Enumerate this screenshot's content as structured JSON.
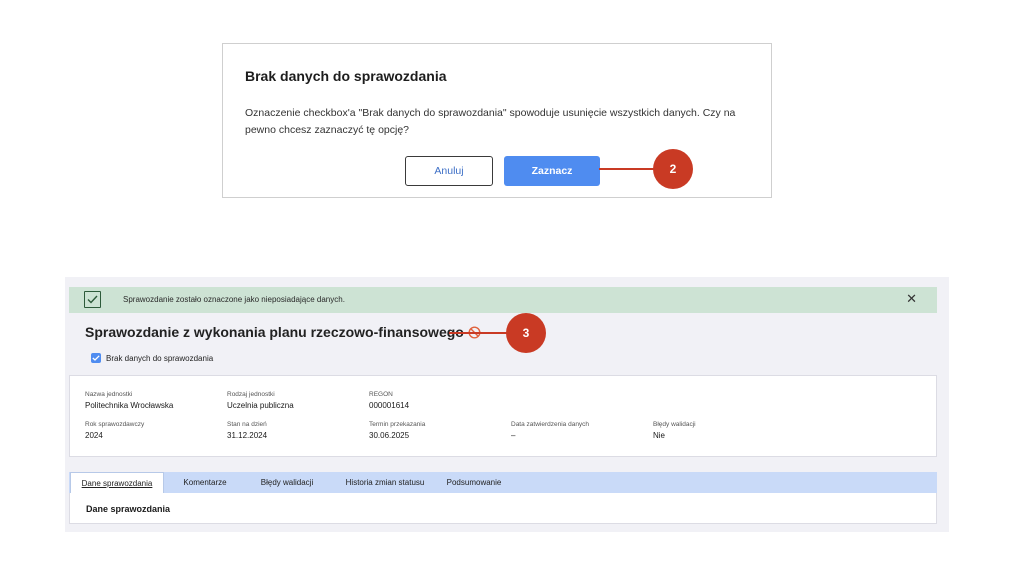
{
  "dialog": {
    "title": "Brak danych do sprawozdania",
    "message": "Oznaczenie checkbox'a \"Brak danych do sprawozdania\" spowoduje usunięcie wszystkich danych. Czy na pewno chcesz zaznaczyć tę opcję?",
    "cancel_label": "Anuluj",
    "confirm_label": "Zaznacz"
  },
  "callouts": {
    "first": "2",
    "second": "3"
  },
  "alert": {
    "text": "Sprawozdanie zostało oznaczone jako nieposiadające danych.",
    "close_icon": "close-icon"
  },
  "report": {
    "title": "Sprawozdanie z wykonania planu rzeczowo-finansowego",
    "title_icon": "ban-icon",
    "checkbox_label": "Brak danych do sprawozdania",
    "checkbox_checked": true
  },
  "info": {
    "unit_name_label": "Nazwa jednostki",
    "unit_name_value": "Politechnika Wrocławska",
    "unit_type_label": "Rodzaj jednostki",
    "unit_type_value": "Uczelnia publiczna",
    "regon_label": "REGON",
    "regon_value": "000001614",
    "year_label": "Rok sprawozdawczy",
    "year_value": "2024",
    "as_of_label": "Stan na dzień",
    "as_of_value": "31.12.2024",
    "deadline_label": "Termin przekazania",
    "deadline_value": "30.06.2025",
    "approval_label": "Data zatwierdzenia danych",
    "approval_value": "–",
    "errors_label": "Błędy walidacji",
    "errors_value": "Nie"
  },
  "tabs": [
    {
      "label": "Dane sprawozdania",
      "active": true
    },
    {
      "label": "Komentarze"
    },
    {
      "label": "Błędy walidacji"
    },
    {
      "label": "Historia zmian statusu"
    },
    {
      "label": "Podsumowanie"
    }
  ],
  "tab_content": {
    "title": "Dane sprawozdania"
  },
  "colors": {
    "primary": "#4f8cf0",
    "callout": "#c93a24",
    "success_bg": "#cde3d4",
    "tab_bar": "#c9daf8"
  }
}
